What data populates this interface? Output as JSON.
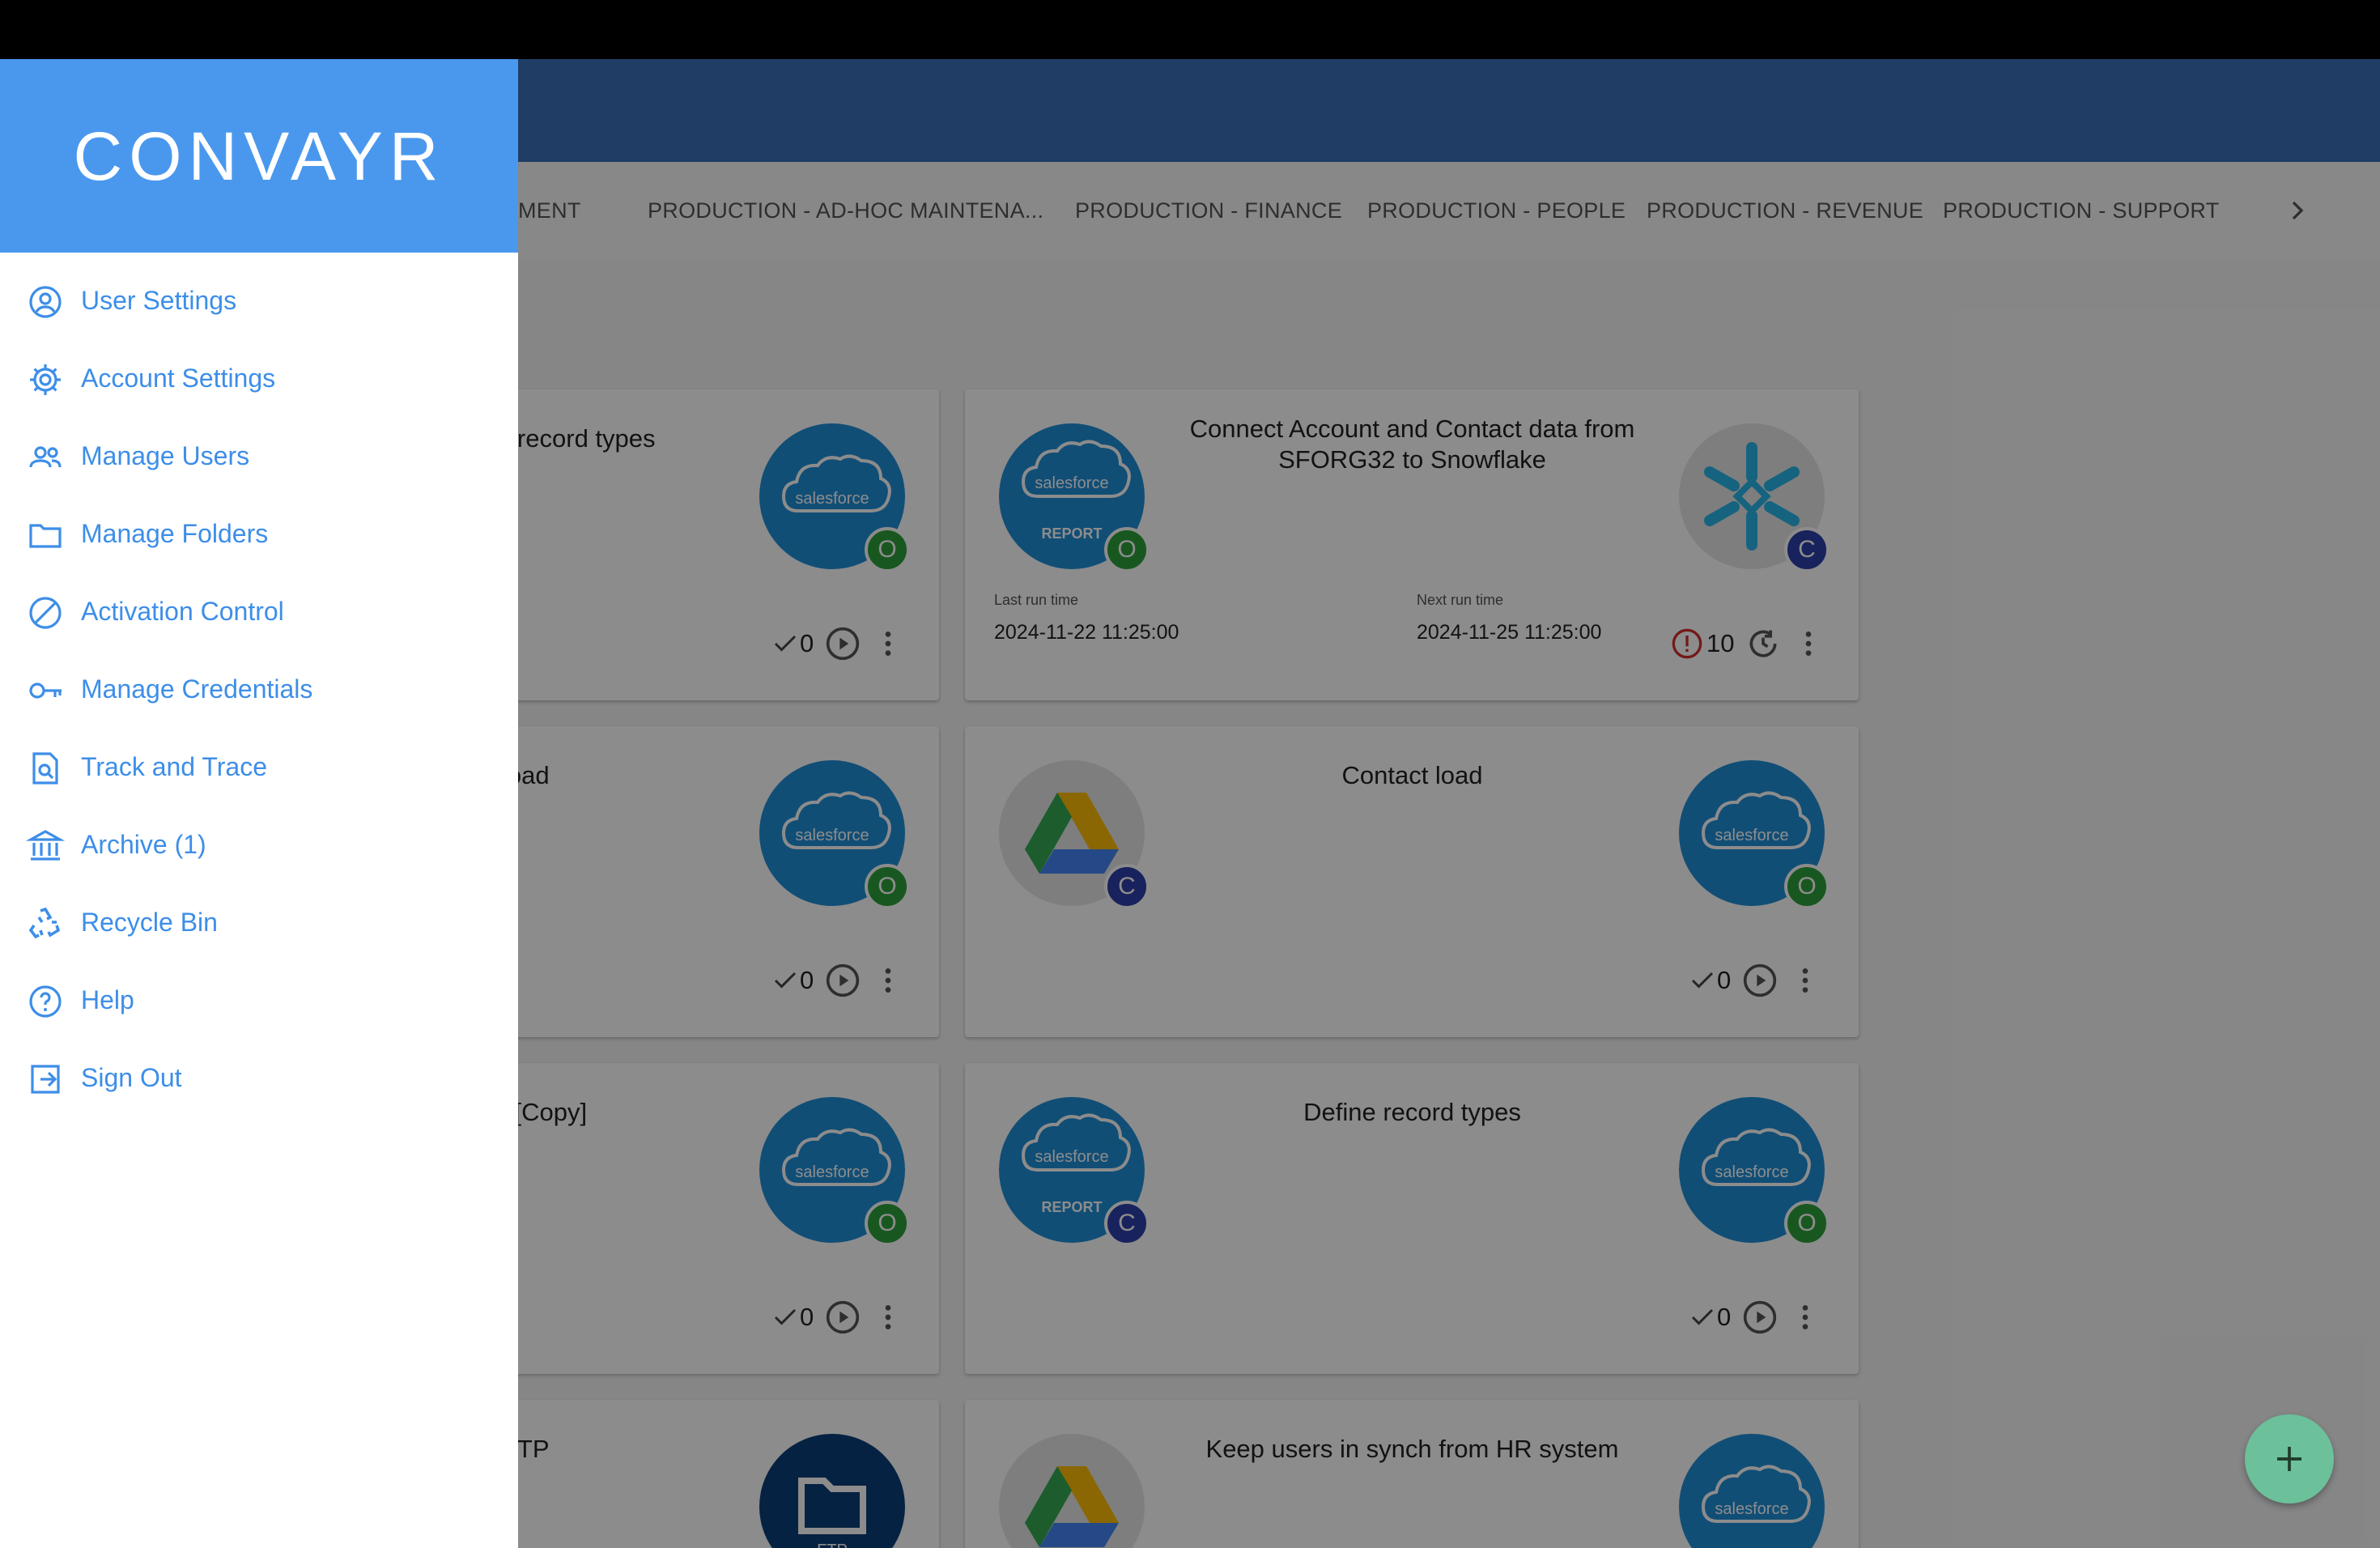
{
  "app": {
    "logo_text": "CONVAYR"
  },
  "tabs": [
    "MENT",
    "PRODUCTION - AD-HOC MAINTENA...",
    "PRODUCTION - FINANCE",
    "PRODUCTION - PEOPLE",
    "PRODUCTION - REVENUE",
    "PRODUCTION - SUPPORT"
  ],
  "cards": {
    "c1": {
      "title": "r record types",
      "count": "0"
    },
    "c2": {
      "title": "Connect Account and Contact data from SFORG32 to Snowflake",
      "last_run_label": "Last run time",
      "last_run": "2024-11-22 11:25:00",
      "next_run_label": "Next run time",
      "next_run": "2024-11-25 11:25:00",
      "error_count": "10"
    },
    "c3": {
      "title": "load",
      "count": "0"
    },
    "c4": {
      "title": "Contact load",
      "count": "0"
    },
    "c5": {
      "title": "l [Copy]",
      "count": "0"
    },
    "c6": {
      "title": "Define record types",
      "count": "0"
    },
    "c7": {
      "title": "FTP"
    },
    "c8": {
      "title": "Keep users in synch from HR system"
    }
  },
  "badges": {
    "o": "O",
    "c": "C"
  },
  "logos": {
    "salesforce": "salesforce",
    "report": "REPORT",
    "ftp": "FTP"
  },
  "menu": {
    "user_settings": "User Settings",
    "account_settings": "Account Settings",
    "manage_users": "Manage Users",
    "manage_folders": "Manage Folders",
    "activation_control": "Activation Control",
    "manage_credentials": "Manage Credentials",
    "track_and_trace": "Track and Trace",
    "archive": "Archive (1)",
    "recycle_bin": "Recycle Bin",
    "help": "Help",
    "sign_out": "Sign Out"
  },
  "colors": {
    "accent": "#4a98ee",
    "appbar": "#3a6fb8",
    "badge_o": "#2e9e3b",
    "badge_c": "#2d3fa8",
    "error": "#d32f2f",
    "fab": "#6cc19a"
  }
}
